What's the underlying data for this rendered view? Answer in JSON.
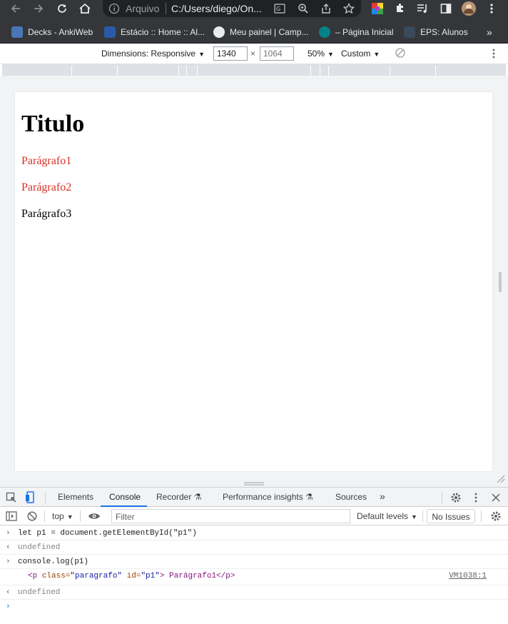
{
  "browser": {
    "security_label": "Arquivo",
    "url": "C:/Users/diego/On...",
    "bookmarks": [
      {
        "label": "Decks - AnkiWeb",
        "color": "#4a76b8"
      },
      {
        "label": "Estácio :: Home :: Al...",
        "color": "#2a5aa8"
      },
      {
        "label": "Meu painel | Camp...",
        "color": "#e8eaed"
      },
      {
        "label": "– Página Inicial",
        "color": "#038387"
      },
      {
        "label": "EPS: Alunos",
        "color": "#3a4a5a"
      }
    ],
    "more_bookmarks": "»"
  },
  "device_toolbar": {
    "dimensions_label": "Dimensions: Responsive",
    "width_value": "1340",
    "height_value": "1064",
    "times": "×",
    "zoom": "50%",
    "throttle": "Custom"
  },
  "page": {
    "title": "Titulo",
    "paragraphs": [
      {
        "text": "Parágrafo1",
        "color": "#d93025"
      },
      {
        "text": "Parágrafo2",
        "color": "#d93025"
      },
      {
        "text": "Parágrafo3",
        "color": "#000000"
      }
    ]
  },
  "devtools": {
    "tabs": [
      "Elements",
      "Console",
      "Recorder",
      "Performance insights",
      "Sources"
    ],
    "active_tab": "Console",
    "more_tabs": "»",
    "context": "top",
    "filter_placeholder": "Filter",
    "levels": "Default levels",
    "issues": "No Issues"
  },
  "console": {
    "lines": [
      {
        "type": "input",
        "text": "let p1 = document.getElementById(\"p1\")"
      },
      {
        "type": "result",
        "text": "undefined"
      },
      {
        "type": "input",
        "text": "console.log(p1)"
      },
      {
        "type": "log",
        "tag_open": "<p ",
        "attr1": "class=",
        "val1": "\"paragrafo\"",
        "attr2": " id=",
        "val2": "\"p1\"",
        "inner": "> Parágrafo1</p>",
        "source": "VM1038:1"
      },
      {
        "type": "result",
        "text": "undefined"
      }
    ]
  }
}
